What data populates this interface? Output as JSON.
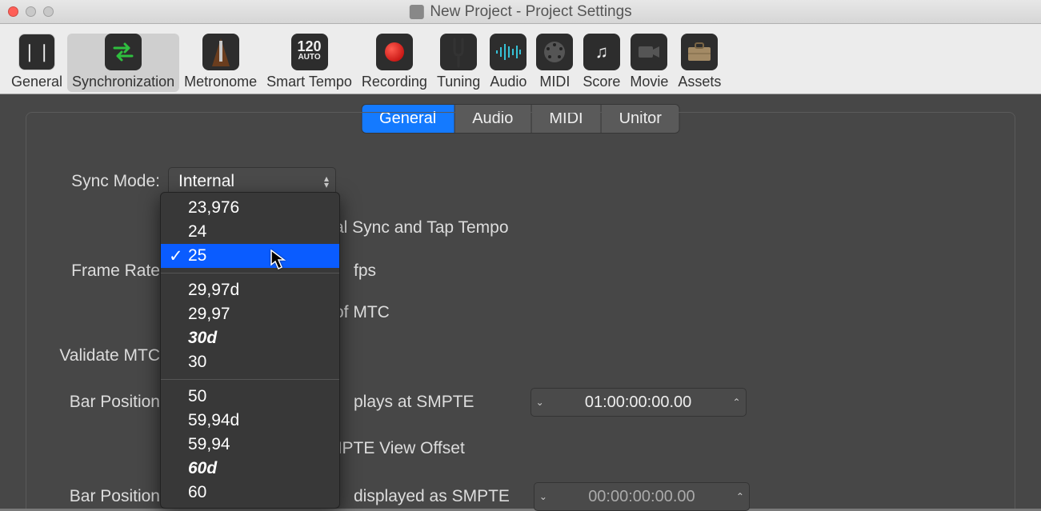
{
  "window": {
    "title": "New Project - Project Settings"
  },
  "toolbar": {
    "items": [
      {
        "label": "General"
      },
      {
        "label": "Synchronization"
      },
      {
        "label": "Metronome"
      },
      {
        "label": "Smart Tempo"
      },
      {
        "label": "Recording"
      },
      {
        "label": "Tuning"
      },
      {
        "label": "Audio"
      },
      {
        "label": "MIDI"
      },
      {
        "label": "Score"
      },
      {
        "label": "Movie"
      },
      {
        "label": "Assets"
      }
    ],
    "tempo_number": "120",
    "tempo_sub": "AUTO"
  },
  "tabs": {
    "items": [
      "General",
      "Audio",
      "MIDI",
      "Unitor"
    ],
    "active": "General"
  },
  "form": {
    "sync_mode_label": "Sync Mode:",
    "sync_mode_value": "Internal",
    "sync_tap_suffix": "al Sync and Tap Tempo",
    "frame_rate_label": "Frame Rate",
    "fps_label": "fps",
    "mtc_suffix": "of MTC",
    "validate_label": "Validate MTC",
    "bar_position_label": "Bar Position",
    "plays_at_smpte": "plays at SMPTE",
    "smpte1_value": "01:00:00:00.00",
    "view_offset_suffix": "MPTE View Offset",
    "displayed_as_smpte": "displayed as SMPTE",
    "smpte2_value": "00:00:00:00.00"
  },
  "frame_rate_menu": {
    "group1": [
      "23,976",
      "24",
      "25"
    ],
    "group2": [
      "29,97d",
      "29,97",
      "30d",
      "30"
    ],
    "group3": [
      "50",
      "59,94d",
      "59,94",
      "60d",
      "60"
    ],
    "selected": "25",
    "italic": [
      "30d",
      "60d"
    ]
  }
}
